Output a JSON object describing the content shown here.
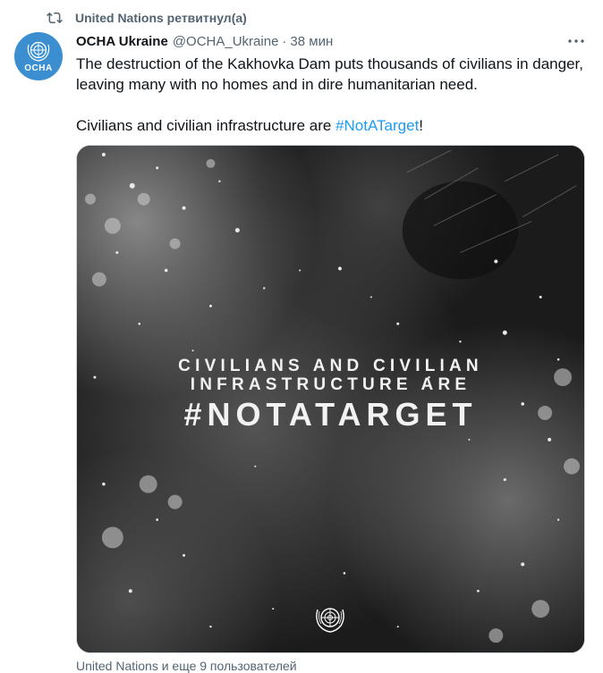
{
  "retweet": {
    "icon": "retweet-icon",
    "label": "United Nations ретвитнул(а)"
  },
  "author": {
    "avatar_label": "OCHA",
    "name": "OCHA Ukraine",
    "handle": "@OCHA_Ukraine",
    "separator": "·",
    "time": "38 мин"
  },
  "tweet": {
    "paragraph1": "The destruction of the Kakhovka Dam puts thousands of civilians in danger, leaving many with no homes and in dire humanitarian need.",
    "paragraph2_prefix": "Civilians and civilian infrastructure are ",
    "hashtag": "#NotATarget",
    "paragraph2_suffix": "!"
  },
  "media": {
    "line1": "CIVILIANS AND CIVILIAN",
    "line2": "INFRASTRUCTURE ARE",
    "line3": "#NOTATARGET",
    "emblem": "un-emblem-icon"
  },
  "footer": {
    "liked_by": "United Nations и еще 9 пользователей"
  },
  "colors": {
    "link": "#1d9bf0",
    "muted": "#536471",
    "text": "#0f1419",
    "avatar_bg": "#3b8fd1"
  }
}
